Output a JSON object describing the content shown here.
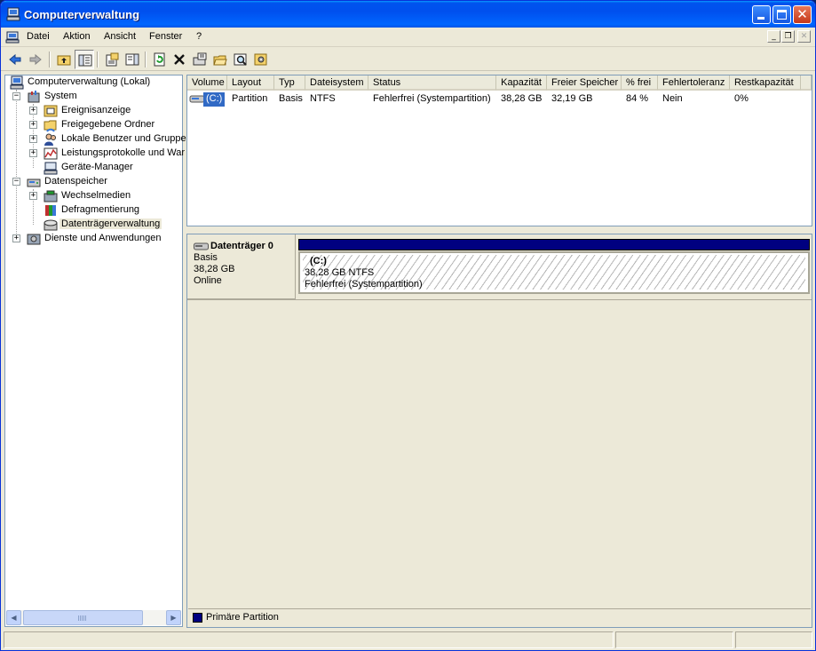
{
  "window": {
    "title": "Computerverwaltung",
    "title_color": "#0053EE",
    "close_glyph": "✕"
  },
  "menubar": {
    "items": [
      "Datei",
      "Aktion",
      "Ansicht",
      "Fenster",
      "?"
    ],
    "mdi_min": "_",
    "mdi_restore": "❐",
    "mdi_close": "✕"
  },
  "toolbar": {
    "buttons": [
      "back-icon",
      "forward-icon",
      "up-folder-icon",
      "show-hide-tree-icon",
      "properties-icon",
      "show-hide-action-pane-icon",
      "refresh-icon",
      "delete-icon",
      "disk-properties-icon",
      "open-icon",
      "search-icon",
      "settings-icon"
    ]
  },
  "tree": {
    "root": "Computerverwaltung (Lokal)",
    "system": "System",
    "ereignis": "Ereignisanzeige",
    "freigegeben": "Freigegebene Ordner",
    "lokale": "Lokale Benutzer und Gruppe",
    "leistung": "Leistungsprotokolle und War",
    "geraete": "Geräte-Manager",
    "datenspeicher": "Datenspeicher",
    "wechsel": "Wechselmedien",
    "defrag": "Defragmentierung",
    "datentraeger": "Datenträgerverwaltung",
    "dienste": "Dienste und Anwendungen",
    "plus": "+",
    "minus": "−"
  },
  "volume_list": {
    "columns": [
      "Volume",
      "Layout",
      "Typ",
      "Dateisystem",
      "Status",
      "Kapazität",
      "Freier Speicher",
      "% frei",
      "Fehlertoleranz",
      "Restkapazität"
    ],
    "rows": [
      {
        "volume": "(C:)",
        "layout": "Partition",
        "typ": "Basis",
        "dateisystem": "NTFS",
        "status": "Fehlerfrei (Systempartition)",
        "kapazitaet": "38,28 GB",
        "freier_speicher": "32,19 GB",
        "prozent_frei": "84 %",
        "fehlertoleranz": "Nein",
        "restkapazitaet": "0%"
      }
    ]
  },
  "disk": {
    "name": "Datenträger 0",
    "type": "Basis",
    "size": "38,28 GB",
    "state": "Online",
    "partition": {
      "name": "(C:)",
      "size_fs": "38,28 GB NTFS",
      "status": "Fehlerfrei (Systempartition)",
      "bar_color": "#000080"
    }
  },
  "legend": {
    "label": "Primäre Partition",
    "color": "#000080"
  }
}
